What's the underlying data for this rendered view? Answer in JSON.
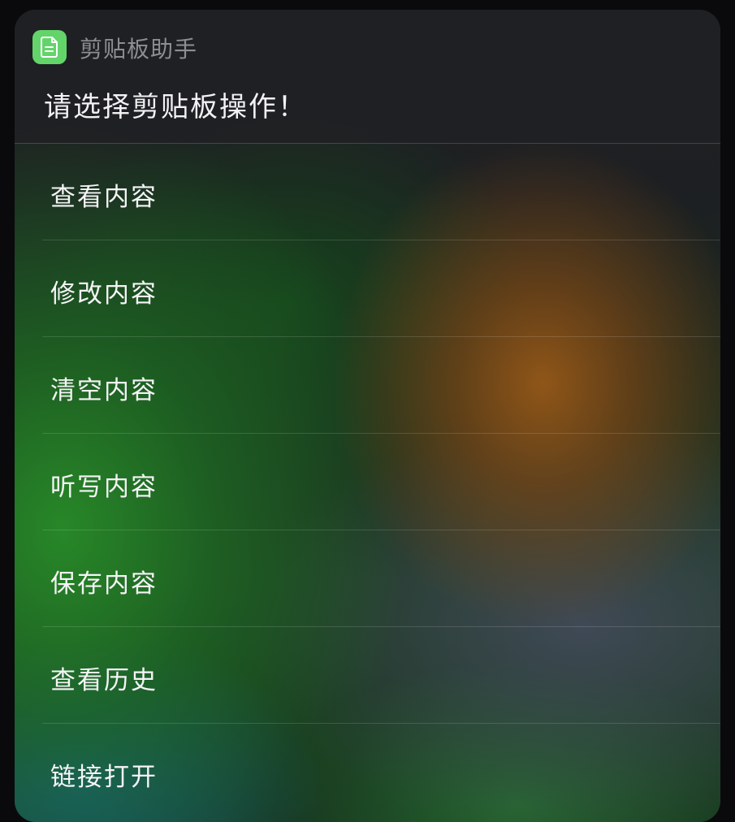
{
  "app": {
    "name": "剪贴板助手",
    "icon": "document-icon",
    "icon_color": "#63d46a"
  },
  "prompt": "请选择剪贴板操作！",
  "menu": {
    "items": [
      {
        "label": "查看内容"
      },
      {
        "label": "修改内容"
      },
      {
        "label": "清空内容"
      },
      {
        "label": "听写内容"
      },
      {
        "label": "保存内容"
      },
      {
        "label": "查看历史"
      },
      {
        "label": "链接打开"
      }
    ]
  }
}
